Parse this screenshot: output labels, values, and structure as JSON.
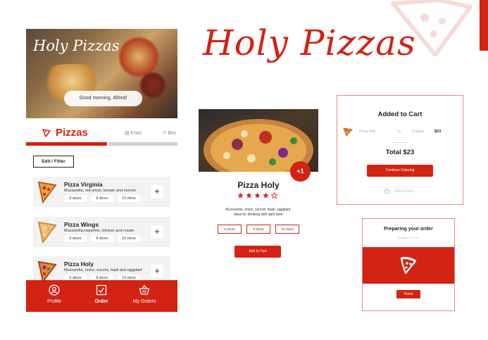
{
  "brand": {
    "title": "Holy Pizzas"
  },
  "phone": {
    "hero_title": "Holy Pizzas",
    "greeting": "Good morning, Alfred!",
    "tabs": [
      {
        "label": "Pizzas",
        "active": true
      },
      {
        "label": "Fries",
        "active": false
      },
      {
        "label": "Bev",
        "active": false
      }
    ],
    "edit_filter": "Edit / Filter",
    "items": [
      {
        "name": "Pizza Virginia",
        "desc": "Muzzarella, red onion, tomato and morron",
        "sizes": [
          "6 slices",
          "8 slices",
          "10 slices"
        ],
        "plus": "+"
      },
      {
        "name": "Pizza Wings",
        "desc": "Muzzarella,roquefort, chicken and cream",
        "sizes": [
          "6 slices",
          "8 slices",
          "10 slices"
        ],
        "plus": "+"
      },
      {
        "name": "Pizza Holy",
        "desc": "Muzzarella, onion, zuccini, basil and eggplant",
        "sizes": [
          "6 slices",
          "8 slices",
          "10 slices"
        ],
        "plus": "+"
      }
    ],
    "nav": [
      {
        "label": "Profile",
        "icon": "user-icon"
      },
      {
        "label": "Order",
        "icon": "order-icon"
      },
      {
        "label": "My Orders",
        "icon": "basket-icon"
      }
    ]
  },
  "detail": {
    "badge": "+1",
    "name": "Pizza Holy",
    "rating": 4,
    "rating_max": 5,
    "desc_line1": "Muzzarella, onion, zuccini, basil, eggplant.",
    "desc_line2": "Ideal for drinking with dark beer",
    "sizes": [
      "6 slices",
      "8 slices",
      "10 slices"
    ],
    "add_to_cart": "Add to Cart"
  },
  "cart": {
    "title": "Added to Cart",
    "item_name": "Pizza Holy",
    "qty": "1x",
    "slices": "8 Slices",
    "price": "$23",
    "total": "Total $23",
    "continue": "Continue Ordering",
    "checkout": "Check Out"
  },
  "prep": {
    "title": "Preparing your order",
    "sub": "Ready in 5 mins",
    "home": "Home"
  },
  "colors": {
    "accent": "#d22313",
    "card_bg": "#f2f2f2",
    "border": "#e08a82"
  }
}
